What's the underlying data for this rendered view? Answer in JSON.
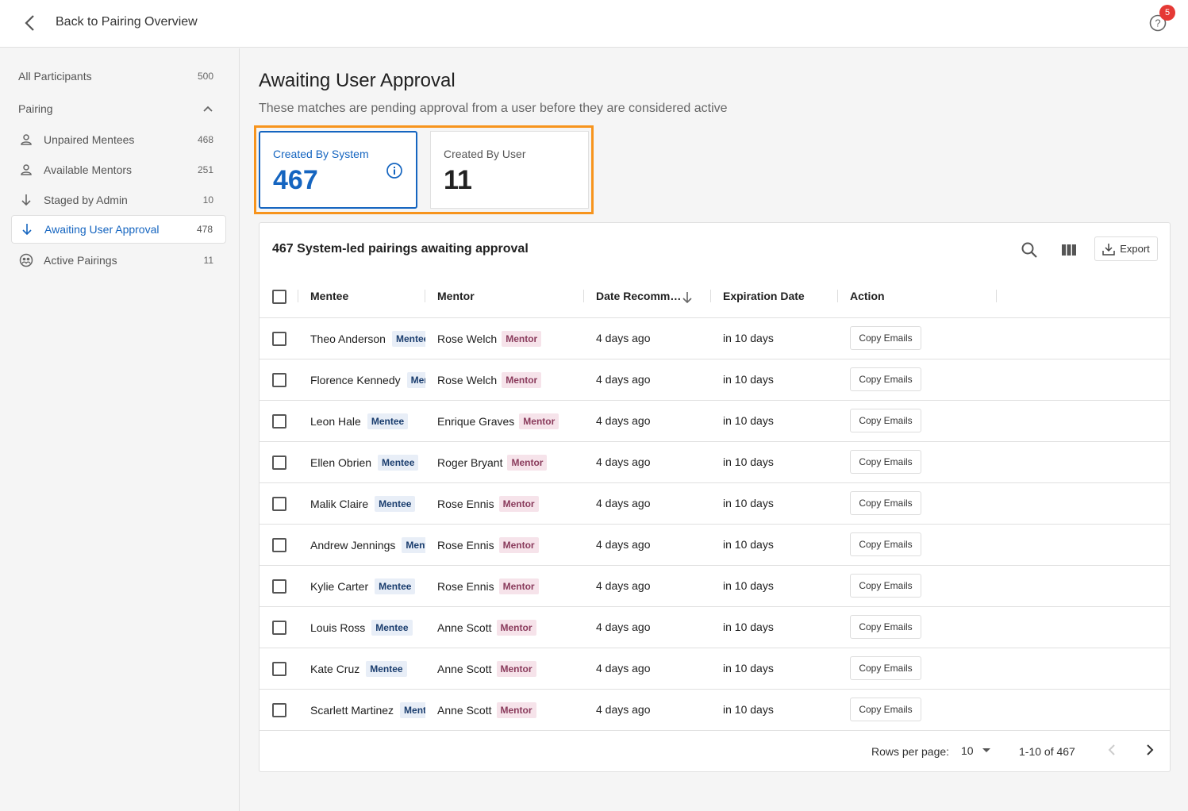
{
  "topbar": {
    "back_label": "Back to Pairing Overview",
    "help_badge": "5"
  },
  "sidebar": {
    "all_participants": {
      "label": "All Participants",
      "count": "500"
    },
    "section_label": "Pairing",
    "items": [
      {
        "label": "Unpaired Mentees",
        "count": "468",
        "icon": "person-icon"
      },
      {
        "label": "Available Mentors",
        "count": "251",
        "icon": "person-icon"
      },
      {
        "label": "Staged by Admin",
        "count": "10",
        "icon": "arrow-down-icon"
      },
      {
        "label": "Awaiting User Approval",
        "count": "478",
        "icon": "arrow-down-icon"
      },
      {
        "label": "Active Pairings",
        "count": "11",
        "icon": "pairing-icon"
      }
    ]
  },
  "main": {
    "title": "Awaiting User Approval",
    "subtitle": "These matches are pending approval from a user before they are considered active",
    "cards": [
      {
        "label": "Created By System",
        "value": "467"
      },
      {
        "label": "Created By User",
        "value": "11"
      }
    ]
  },
  "table": {
    "title": "467 System-led pairings awaiting approval",
    "export_label": "Export",
    "columns": [
      "Mentee",
      "Mentor",
      "Date Recomm…",
      "Expiration Date",
      "Action"
    ],
    "mentee_tag": "Mentee",
    "mentor_tag": "Mentor",
    "copy_label": "Copy Emails",
    "rows": [
      {
        "mentee": "Theo Anderson",
        "mentor": "Rose Welch",
        "date": "4 days ago",
        "expires": "in 10 days"
      },
      {
        "mentee": "Florence Kennedy",
        "mentor": "Rose Welch",
        "date": "4 days ago",
        "expires": "in 10 days"
      },
      {
        "mentee": "Leon Hale",
        "mentor": "Enrique Graves",
        "date": "4 days ago",
        "expires": "in 10 days"
      },
      {
        "mentee": "Ellen Obrien",
        "mentor": "Roger Bryant",
        "date": "4 days ago",
        "expires": "in 10 days"
      },
      {
        "mentee": "Malik Claire",
        "mentor": "Rose Ennis",
        "date": "4 days ago",
        "expires": "in 10 days"
      },
      {
        "mentee": "Andrew Jennings",
        "mentor": "Rose Ennis",
        "date": "4 days ago",
        "expires": "in 10 days"
      },
      {
        "mentee": "Kylie Carter",
        "mentor": "Rose Ennis",
        "date": "4 days ago",
        "expires": "in 10 days"
      },
      {
        "mentee": "Louis Ross",
        "mentor": "Anne Scott",
        "date": "4 days ago",
        "expires": "in 10 days"
      },
      {
        "mentee": "Kate Cruz",
        "mentor": "Anne Scott",
        "date": "4 days ago",
        "expires": "in 10 days"
      },
      {
        "mentee": "Scarlett Martinez",
        "mentor": "Anne Scott",
        "date": "4 days ago",
        "expires": "in 10 days"
      }
    ],
    "footer": {
      "rows_per_page_label": "Rows per page:",
      "rows_per_page_value": "10",
      "range": "1-10 of 467"
    }
  },
  "colors": {
    "accent": "#1565c0",
    "highlight": "#f7941d",
    "badge": "#e53935"
  }
}
